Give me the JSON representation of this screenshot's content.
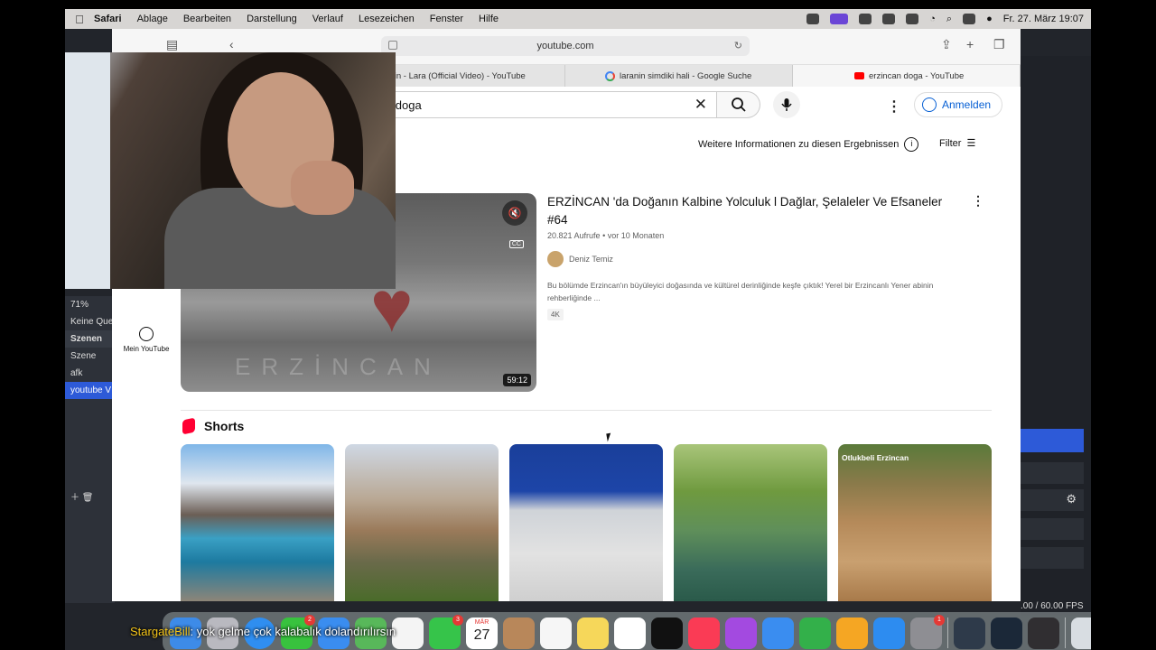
{
  "menubar": {
    "app": "Safari",
    "items": [
      "Ablage",
      "Bearbeiten",
      "Darstellung",
      "Verlauf",
      "Lesezeichen",
      "Fenster",
      "Hilfe"
    ],
    "datetime": "Fr. 27. März 19:07"
  },
  "safari": {
    "url": "youtube.com",
    "tabs": [
      {
        "title": "Allah Versin - Lara (Official Video) - YouTube"
      },
      {
        "title": "laranin simdiki hali - Google Suche"
      },
      {
        "title": "erzincan doga - YouTube"
      }
    ]
  },
  "youtube": {
    "search_value": "erzincan doga",
    "signin_label": "Anmelden",
    "info_label": "Weitere Informationen zu diesen Ergebnissen",
    "filter_label": "Filter",
    "sidebar_my_youtube": "Mein YouTube",
    "video": {
      "title": "ERZİNCAN 'da Doğanın Kalbine Yolculuk l Dağlar, Şelaleler Ve Efsaneler #64",
      "views": "20.821 Aufrufe",
      "age": "vor 10 Monaten",
      "channel": "Deniz Temiz",
      "description": "Bu bölümde Erzincan'ın büyüleyici doğasında ve kültürel derinliğinde keşfe çıktık! Yerel bir Erzincanlı Yener abinin rehberliğinde ...",
      "badge": "4K",
      "duration": "59:12",
      "watermark": "ERZİNCAN",
      "cc": "CC"
    },
    "shorts_title": "Shorts",
    "short_labels": [
      "",
      "",
      "",
      "",
      "Otlukbeli Erzincan"
    ]
  },
  "obs": {
    "zoom": "71%",
    "sources_empty": "Keine Que",
    "scenes_header": "Szenen",
    "scenes": [
      "Szene",
      "afk",
      "youtube V"
    ],
    "fps": ".00 / 60.00 FPS"
  },
  "dock": {
    "badges": {
      "messages": "2",
      "facetime": "3",
      "settings": "1"
    },
    "calendar_month": "MÄR",
    "calendar_day": "27"
  },
  "subtitle": {
    "name": "StargateBill",
    "text": "yok gelme çok kalabalık dolandırılırsın"
  },
  "colors": {
    "youtube_red": "#ff0000",
    "link_blue": "#065fd4",
    "obs_selected": "#2d5ad8"
  }
}
